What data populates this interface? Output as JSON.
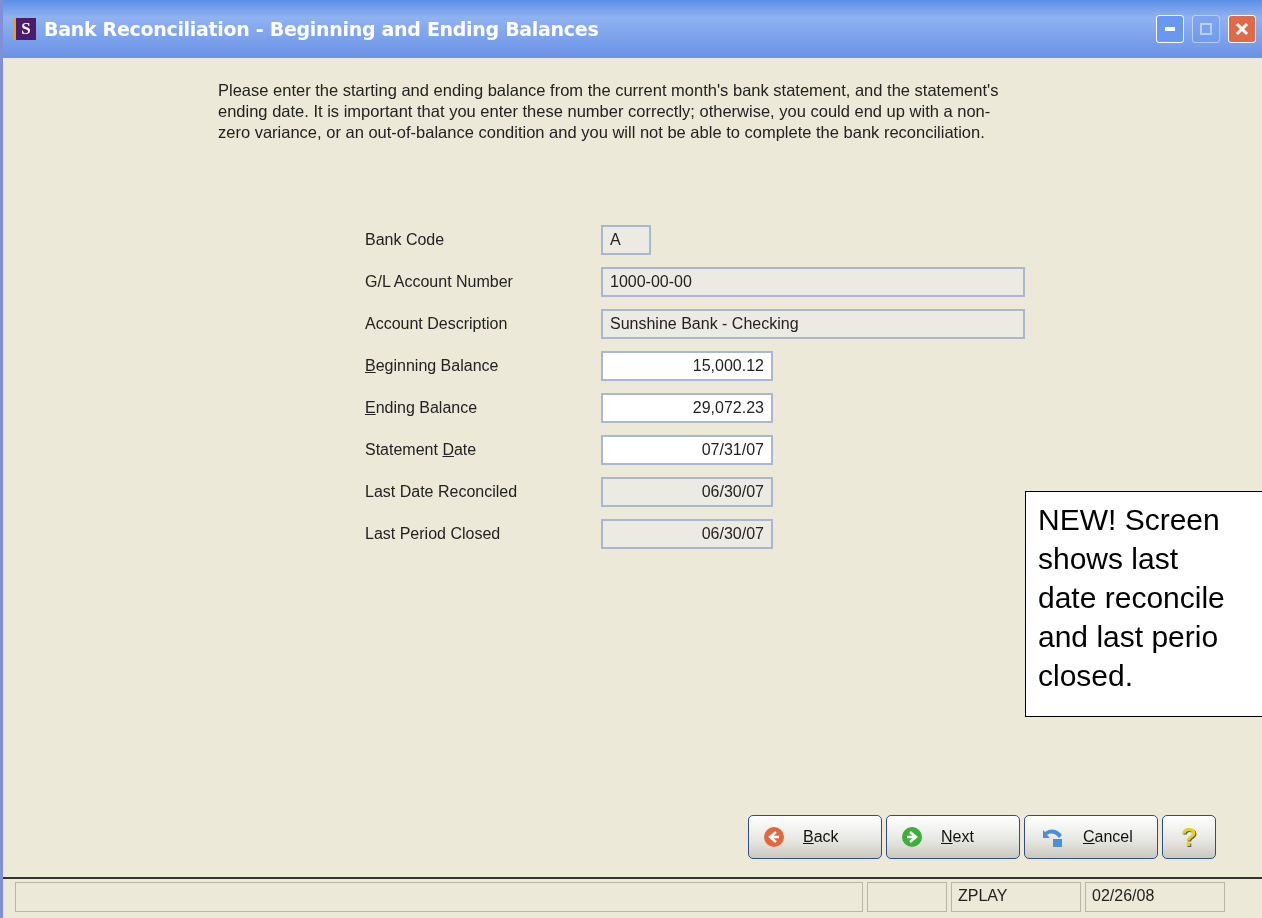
{
  "window": {
    "title": "Bank Reconciliation - Beginning and Ending Balances",
    "app_letter": "S",
    "maximize_disabled": true
  },
  "instructions": "Please enter the starting and ending balance from the current month's bank statement, and the statement's ending date.  It is important that you enter these number correctly; otherwise, you could end up with a non-zero variance, or an out-of-balance condition and you will not be able to complete the bank reconciliation.",
  "fields": [
    {
      "label": {
        "pre": "Bank Code"
      },
      "value": "A",
      "kind": "code",
      "disabled": true
    },
    {
      "label": {
        "pre": "G/L Account Number"
      },
      "value": "1000-00-00",
      "kind": "text",
      "disabled": true
    },
    {
      "label": {
        "pre": "Account Description"
      },
      "value": "Sunshine Bank - Checking",
      "kind": "text",
      "disabled": true
    },
    {
      "label": {
        "key": "B",
        "post": "eginning Balance"
      },
      "value": "15,000.12",
      "kind": "amount",
      "disabled": false
    },
    {
      "label": {
        "key": "E",
        "post": "nding Balance"
      },
      "value": "29,072.23",
      "kind": "amount",
      "disabled": false
    },
    {
      "label": {
        "pre": "Statement ",
        "key": "D",
        "post": "ate"
      },
      "value": "07/31/07",
      "kind": "amount",
      "disabled": false
    },
    {
      "label": {
        "pre": "Last Date Reconciled"
      },
      "value": "06/30/07",
      "kind": "amount",
      "disabled": true
    },
    {
      "label": {
        "pre": "Last Period Closed"
      },
      "value": "06/30/07",
      "kind": "amount",
      "disabled": true
    }
  ],
  "callout_lines": [
    "NEW! Screen",
    "shows last",
    "date reconcile",
    "and last perio",
    "closed."
  ],
  "buttons": [
    {
      "kind": "back",
      "label": {
        "key": "B",
        "post": "ack"
      }
    },
    {
      "kind": "next",
      "label": {
        "key": "N",
        "post": "ext"
      }
    },
    {
      "kind": "cancel",
      "label": {
        "key": "C",
        "post": "ancel"
      }
    },
    {
      "kind": "help",
      "glyph": "?"
    }
  ],
  "status_bar": {
    "panels": [
      "ZPLAY",
      "02/26/08"
    ]
  }
}
